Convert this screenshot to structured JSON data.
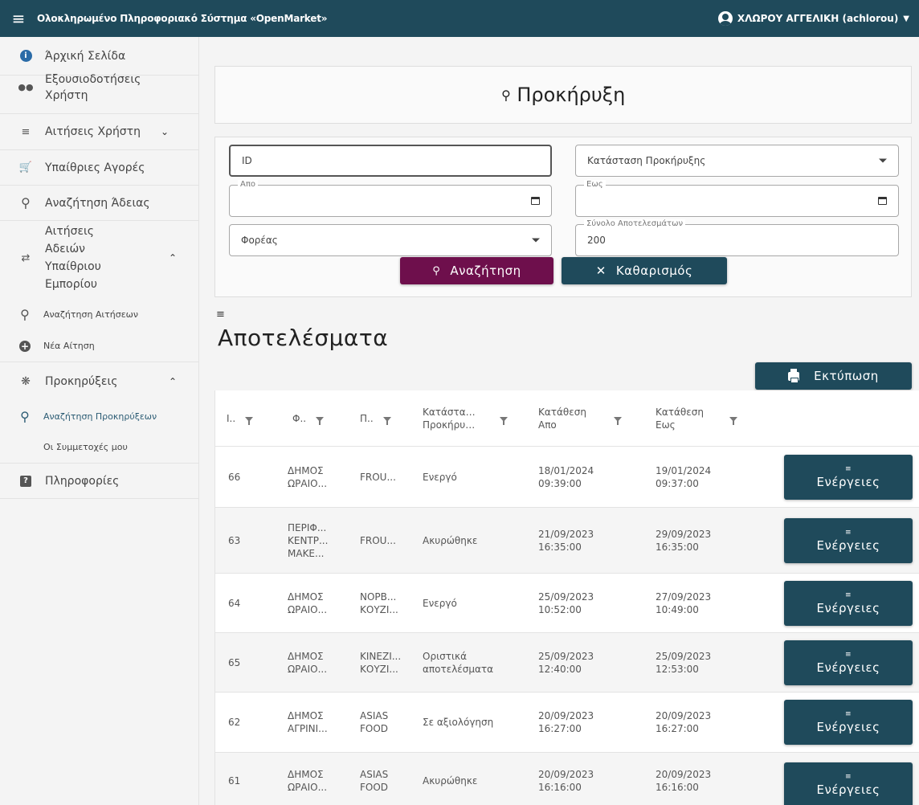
{
  "header": {
    "app_title": "Ολοκληρωμένο Πληροφοριακό Σύστημα «OpenMarket»",
    "user": "ΧΛΩΡΟΥ ΑΓΓΕΛΙΚΗ (achlorou)"
  },
  "sidebar": {
    "items": [
      {
        "label": "Άρχική Σελίδα",
        "icon": "info-circle-icon"
      },
      {
        "label": "Εξουσιοδοτήσεις Χρήστη",
        "icon": "users-icon"
      },
      {
        "label": "Αιτήσεις Χρήστη",
        "icon": "list-icon"
      },
      {
        "label": "Υπαίθριες Αγορές",
        "icon": "cart-icon"
      },
      {
        "label": "Αναζήτηση Άδειας",
        "icon": "search-icon"
      },
      {
        "label": "Αιτήσεις Αδειών Υπαίθριου Εμπορίου",
        "icon": "swap-icon"
      },
      {
        "label": "Αναζήτηση Αιτήσεων",
        "icon": "search-icon"
      },
      {
        "label": "Νέα Αίτηση",
        "icon": "plus-circle-icon"
      },
      {
        "label": "Προκηρύξεις",
        "icon": "network-icon"
      },
      {
        "label": "Αναζήτηση Προκηρύξεων",
        "icon": "search-icon"
      },
      {
        "label": "Οι Συμμετοχές μου",
        "icon": ""
      },
      {
        "label": "Πληροφορίες",
        "icon": "question-icon"
      }
    ]
  },
  "page": {
    "title": "Προκήρυξη"
  },
  "filters": {
    "id_placeholder": "ID",
    "status_label": "Κατάσταση Προκήρυξης",
    "from_label": "Απο",
    "to_label": "Εως",
    "body_label": "Φορέας",
    "total_label": "Σύνολο Αποτελεσμάτων",
    "total_value": "200",
    "search_button": "Αναζήτηση",
    "clear_button": "Καθαρισμός"
  },
  "results": {
    "title": "Αποτελέσματα",
    "print_button": "Εκτύπωση",
    "action_label": "Ενέργειες",
    "columns": [
      "I..",
      "Φ..",
      "Π..",
      "Κατάστα… Προκήρυ…",
      "Κατάθεση Απο",
      "Κατάθεση Εως"
    ],
    "rows": [
      {
        "id": "66",
        "body": "ΔΗΜΟΣ ΩΡΑΙΟ...",
        "product": "FROU...",
        "status": "Ενεργό",
        "from": "18/01/2024 09:39:00",
        "to": "19/01/2024 09:37:00"
      },
      {
        "id": "63",
        "body": "ΠΕΡΙΦ... ΚΕΝΤΡ... ΜΑΚΕ...",
        "product": "FROU...",
        "status": "Ακυρώθηκε",
        "from": "21/09/2023 16:35:00",
        "to": "29/09/2023 16:35:00"
      },
      {
        "id": "64",
        "body": "ΔΗΜΟΣ ΩΡΑΙΟ...",
        "product": "ΝΟΡΒ... ΚΟΥΖΙ...",
        "status": "Ενεργό",
        "from": "25/09/2023 10:52:00",
        "to": "27/09/2023 10:49:00"
      },
      {
        "id": "65",
        "body": "ΔΗΜΟΣ ΩΡΑΙΟ...",
        "product": "ΚΙΝΕΖΙ... ΚΟΥΖΙ...",
        "status": "Οριστικά αποτελέσματα",
        "from": "25/09/2023 12:40:00",
        "to": "25/09/2023 12:53:00"
      },
      {
        "id": "62",
        "body": "ΔΗΜΟΣ ΑΓΡΙΝΙ...",
        "product": "ASIAS FOOD",
        "status": "Σε αξιολόγηση",
        "from": "20/09/2023 16:27:00",
        "to": "20/09/2023 16:27:00"
      },
      {
        "id": "61",
        "body": "ΔΗΜΟΣ ΩΡΑΙΟ...",
        "product": "ASIAS FOOD",
        "status": "Ακυρώθηκε",
        "from": "20/09/2023 16:16:00",
        "to": "20/09/2023 16:16:00"
      }
    ]
  },
  "colors": {
    "topbar": "#1f4a5b",
    "search_button": "#6e0f4c",
    "primary_button": "#1f4a5b"
  }
}
